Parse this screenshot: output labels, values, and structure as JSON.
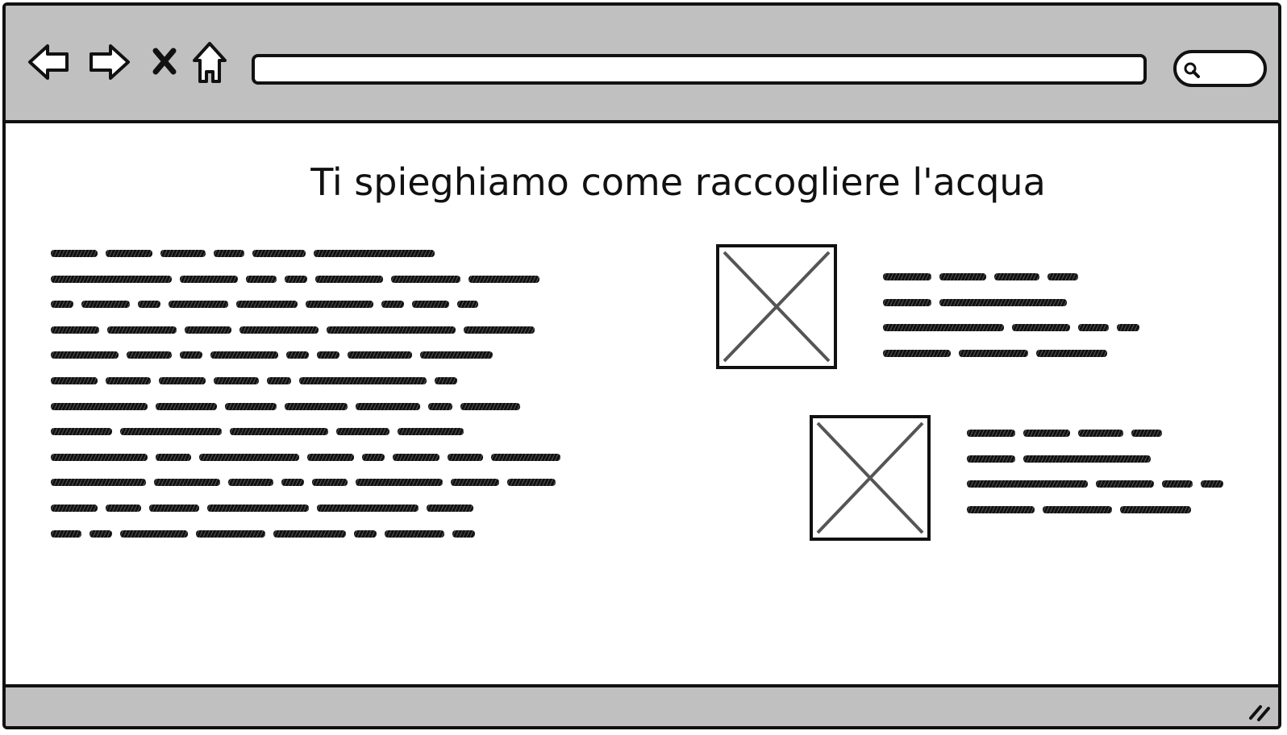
{
  "browser": {
    "url_value": "",
    "search_value": "",
    "icons": [
      "back-arrow-icon",
      "forward-arrow-icon",
      "stop-icon",
      "home-icon",
      "search-icon",
      "resize-grip-icon"
    ]
  },
  "page": {
    "title": "Ti spieghiamo come raccogliere l'acqua"
  },
  "colors": {
    "chrome": "#c0c0c0",
    "stroke": "#111111",
    "placeholder_x": "#555555"
  }
}
